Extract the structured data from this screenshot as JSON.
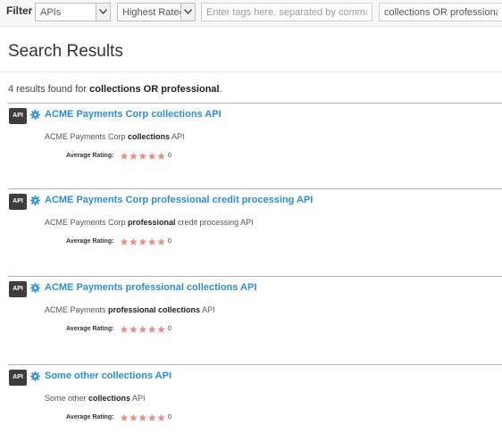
{
  "filter": {
    "label": "Filter",
    "type_select": "APIs",
    "sort_select": "Highest Rated",
    "tags_placeholder": "Enter tags here, separated by commas",
    "query_value": "collections OR professional"
  },
  "page": {
    "title": "Search Results",
    "summary_count": "4 results found for",
    "summary_query": "collections OR professional",
    "summary_end": "."
  },
  "results": [
    {
      "badge": "API",
      "title": "ACME Payments Corp collections API",
      "desc": [
        {
          "text": "ACME Payments Corp ",
          "bold": false
        },
        {
          "text": "collections",
          "bold": true
        },
        {
          "text": " API",
          "bold": false
        }
      ],
      "rating_label": "Average Rating:",
      "rating": 0,
      "rating_value": "0"
    },
    {
      "badge": "API",
      "title": "ACME Payments Corp professional credit processing API",
      "desc": [
        {
          "text": "ACME Payments Corp ",
          "bold": false
        },
        {
          "text": "professional",
          "bold": true
        },
        {
          "text": " credit processing API",
          "bold": false
        }
      ],
      "rating_label": "Average Rating:",
      "rating": 0,
      "rating_value": "0"
    },
    {
      "badge": "API",
      "title": "ACME Payments professional collections API",
      "desc": [
        {
          "text": "ACME Payments ",
          "bold": false
        },
        {
          "text": "professional collections",
          "bold": true
        },
        {
          "text": " API",
          "bold": false
        }
      ],
      "rating_label": "Average Rating:",
      "rating": 0,
      "rating_value": "0"
    },
    {
      "badge": "API",
      "title": "Some other collections API",
      "desc": [
        {
          "text": "Some other ",
          "bold": false
        },
        {
          "text": "collections",
          "bold": true
        },
        {
          "text": " API",
          "bold": false
        }
      ],
      "rating_label": "Average Rating:",
      "rating": 0,
      "rating_value": "0"
    }
  ],
  "colors": {
    "link": "#2a8fd8",
    "star": "#e58d8d",
    "badge": "#3d3d3d"
  },
  "icons": {
    "gear": "gear-icon",
    "star": "star-icon",
    "dropdown": "chevron-down-icon"
  }
}
